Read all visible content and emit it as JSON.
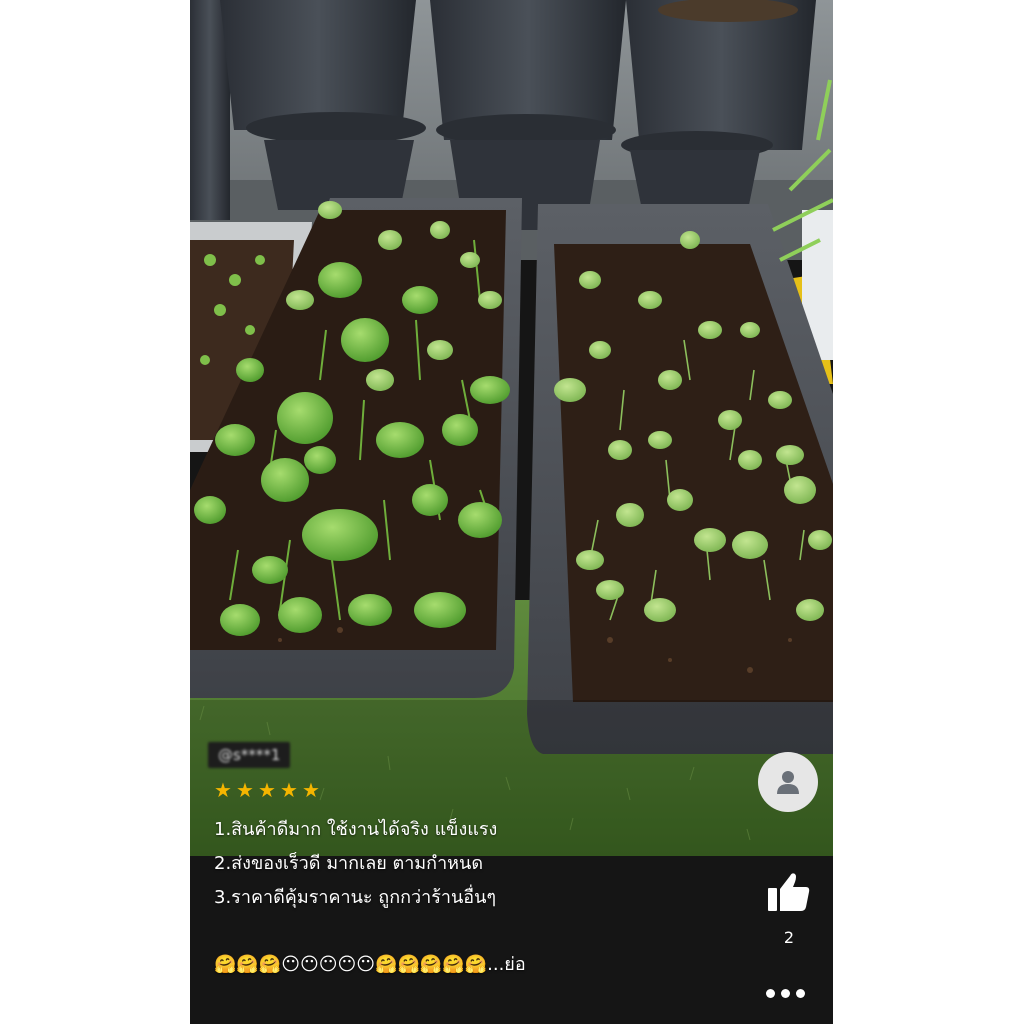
{
  "review": {
    "username": "@s****1",
    "rating": 5,
    "lines": [
      "1.สินค้าดีมาก ใช้งานได้จริง แข็งแรง",
      "2.ส่งของเร็วดี มากเลย ตามกำหนด",
      "3.ราคาดีคุ้มราคานะ ถูกกว่าร้านอื่นๆ"
    ],
    "emoji_line": "🤗🤗🤗😶😶😶😶😶🤗🤗🤗🤗🤗...ย่อ"
  },
  "actions": {
    "like_count": "2"
  },
  "icons": {
    "avatar": "user-avatar-icon",
    "like": "thumbs-up-icon",
    "more": "more-options-icon",
    "star": "star-icon"
  },
  "colors": {
    "star": "#f5b500",
    "panel_background": "#151515",
    "avatar_background": "#e6e6e6"
  }
}
